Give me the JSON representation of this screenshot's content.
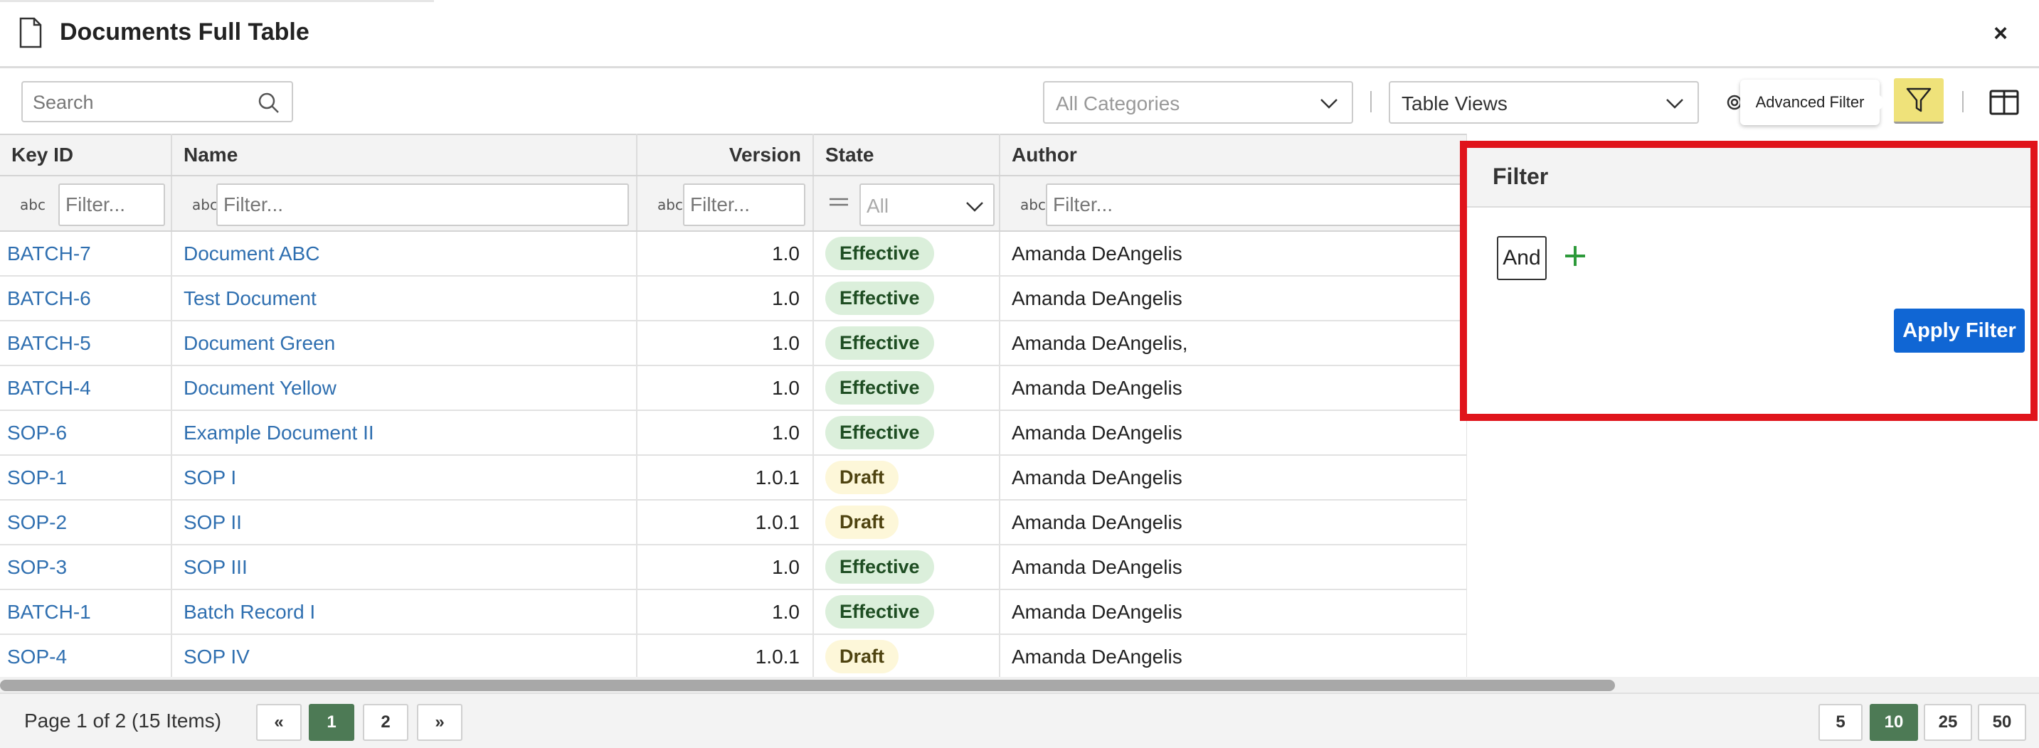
{
  "header": {
    "title": "Documents Full Table",
    "close_label": "×"
  },
  "toolbar": {
    "search_placeholder": "Search",
    "categories_value": "All Categories",
    "views_value": "Table Views",
    "tooltip": "Advanced Filter"
  },
  "columns": [
    "Key ID",
    "Name",
    "Version",
    "State",
    "Author"
  ],
  "filter_row": {
    "placeholder": "Filter...",
    "state_value": "All",
    "text_icon": "abc"
  },
  "rows": [
    {
      "key": "BATCH-7",
      "name": "Document ABC",
      "version": "1.0",
      "state": "Effective",
      "author": "Amanda DeAngelis"
    },
    {
      "key": "BATCH-6",
      "name": "Test Document",
      "version": "1.0",
      "state": "Effective",
      "author": "Amanda DeAngelis"
    },
    {
      "key": "BATCH-5",
      "name": "Document Green",
      "version": "1.0",
      "state": "Effective",
      "author": "Amanda DeAngelis,"
    },
    {
      "key": "BATCH-4",
      "name": "Document Yellow",
      "version": "1.0",
      "state": "Effective",
      "author": "Amanda DeAngelis"
    },
    {
      "key": "SOP-6",
      "name": "Example Document II",
      "version": "1.0",
      "state": "Effective",
      "author": "Amanda DeAngelis"
    },
    {
      "key": "SOP-1",
      "name": "SOP I",
      "version": "1.0.1",
      "state": "Draft",
      "author": "Amanda DeAngelis"
    },
    {
      "key": "SOP-2",
      "name": "SOP II",
      "version": "1.0.1",
      "state": "Draft",
      "author": "Amanda DeAngelis"
    },
    {
      "key": "SOP-3",
      "name": "SOP III",
      "version": "1.0",
      "state": "Effective",
      "author": "Amanda DeAngelis"
    },
    {
      "key": "BATCH-1",
      "name": "Batch Record I",
      "version": "1.0",
      "state": "Effective",
      "author": "Amanda DeAngelis"
    },
    {
      "key": "SOP-4",
      "name": "SOP IV",
      "version": "1.0.1",
      "state": "Draft",
      "author": "Amanda DeAngelis"
    }
  ],
  "filter_panel": {
    "title": "Filter",
    "and_label": "And",
    "apply_label": "Apply Filter"
  },
  "pagination": {
    "info": "Page 1 of 2 (15 Items)",
    "prev": "«",
    "pages": [
      "1",
      "2"
    ],
    "next": "»",
    "sizes": [
      "5",
      "10",
      "25",
      "50"
    ]
  },
  "colors": {
    "accent_filter_button": "#efe27a",
    "highlight_border": "#e0141b",
    "apply_button": "#1066d4",
    "link": "#2f6fb0",
    "active_page": "#4d7a55"
  }
}
